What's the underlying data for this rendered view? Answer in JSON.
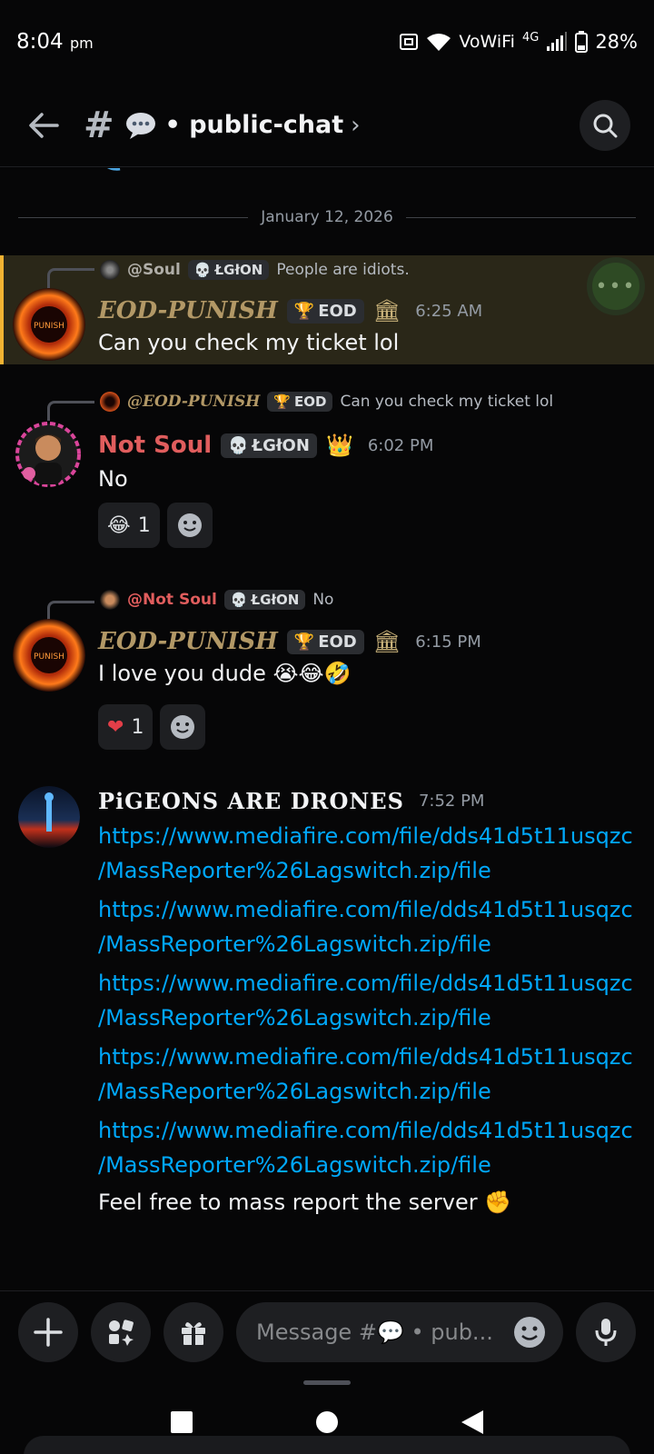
{
  "status_bar": {
    "time": "8:04",
    "ampm": "pm",
    "network": "VoWiFi",
    "cell": "4G",
    "battery": "28%"
  },
  "header": {
    "channel": "public-chat"
  },
  "date_separator": "January 12, 2026",
  "messages": [
    {
      "reply_to": {
        "name": "@Soul",
        "tag": "ŁGłON",
        "text": "People are idiots."
      },
      "author": "EOD-PUNISH",
      "tag": "EOD",
      "time": "6:25 AM",
      "text": "Can you check my ticket lol",
      "highlighted": true
    },
    {
      "reply_to": {
        "name": "@EOD-PUNISH",
        "tag": "EOD",
        "text": "Can you check my ticket lol"
      },
      "author": "Not Soul",
      "tag": "ŁGłON",
      "time": "6:02 PM",
      "text": "No",
      "reactions": [
        {
          "emoji": "joy",
          "count": "1"
        }
      ]
    },
    {
      "reply_to": {
        "name": "@Not Soul",
        "tag": "ŁGłON",
        "text": "No"
      },
      "author": "EOD-PUNISH",
      "tag": "EOD",
      "time": "6:15 PM",
      "text": "I love you dude",
      "reactions": [
        {
          "emoji": "heart",
          "count": "1"
        }
      ]
    },
    {
      "author": "PiGEONS ARE DRONES",
      "time": "7:52 PM",
      "links": [
        [
          "https://www.mediafire.com/file/dds41d5t11usqzc",
          "/MassReporter%26Lagswitch.zip/file"
        ],
        [
          "https://www.mediafire.com/file/dds41d5t11usqzc",
          "/MassReporter%26Lagswitch.zip/file"
        ],
        [
          "https://www.mediafire.com/file/dds41d5t11usqzc",
          "/MassReporter%26Lagswitch.zip/file"
        ],
        [
          "https://www.mediafire.com/file/dds41d5t11usqzc",
          "/MassReporter%26Lagswitch.zip/file"
        ],
        [
          "https://www.mediafire.com/file/dds41d5t11usqzc",
          "/MassReporter%26Lagswitch.zip/file"
        ]
      ],
      "text": "Feel free to mass report the server"
    }
  ],
  "composer": {
    "placeholder_prefix": "Message #",
    "placeholder_suffix": "• pub..."
  },
  "colors": {
    "eod_name": "#b29866",
    "not_soul_name": "#e05d5d",
    "link": "#00a8fc",
    "highlight_bar": "#f0b232"
  }
}
